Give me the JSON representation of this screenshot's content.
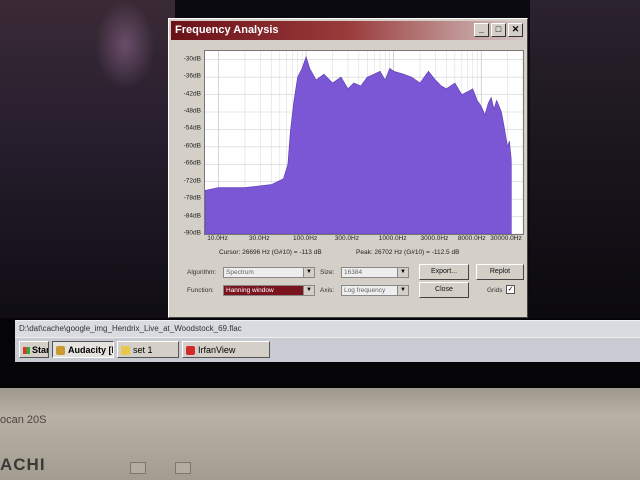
{
  "window": {
    "title": "Frequency Analysis",
    "controls": {
      "minimize": "_",
      "maximize": "□",
      "close": "✕"
    }
  },
  "chart_data": {
    "type": "area",
    "title": "",
    "xlabel": "",
    "ylabel": "",
    "x_scale": "log",
    "xlim": [
      7,
      30000
    ],
    "ylim": [
      -90,
      -27
    ],
    "grid": true,
    "fill_color": "#7b57d6",
    "y_ticks": [
      "-30dB",
      "-36dB",
      "-42dB",
      "-48dB",
      "-54dB",
      "-60dB",
      "-66dB",
      "-72dB",
      "-78dB",
      "-84dB",
      "-90dB"
    ],
    "y_tick_values": [
      -30,
      -36,
      -42,
      -48,
      -54,
      -60,
      -66,
      -72,
      -78,
      -84,
      -90
    ],
    "x_ticks": [
      "10.0Hz",
      "30.0Hz",
      "100.0Hz",
      "300.0Hz",
      "1000.0Hz",
      "3000.0Hz",
      "8000.0Hz",
      "30000.0Hz"
    ],
    "x_tick_values": [
      10,
      30,
      100,
      300,
      1000,
      3000,
      8000,
      30000
    ],
    "series": [
      {
        "x": [
          7,
          10,
          20,
          40,
          55,
          62,
          66,
          72,
          80,
          90,
          100,
          110,
          130,
          160,
          200,
          250,
          300,
          350,
          420,
          500,
          600,
          700,
          800,
          900,
          1000,
          1300,
          1600,
          2000,
          2500,
          3000,
          3500,
          4000,
          5000,
          6000,
          7000,
          8000,
          9000,
          10000,
          11000,
          12000,
          13000,
          14000,
          15000,
          16000,
          17000,
          18000,
          19000,
          20000,
          21000,
          22000,
          22050
        ],
        "y": [
          -75,
          -74,
          -74,
          -73,
          -71,
          -66,
          -55,
          -45,
          -36,
          -33,
          -29,
          -33,
          -37,
          -35,
          -38,
          -36,
          -40,
          -38,
          -39,
          -36,
          -35,
          -34,
          -37,
          -33,
          -34,
          -35,
          -36,
          -38,
          -34,
          -37,
          -39,
          -40,
          -38,
          -42,
          -41,
          -40,
          -44,
          -46,
          -49,
          -45,
          -43,
          -47,
          -44,
          -46,
          -48,
          -52,
          -56,
          -60,
          -58,
          -64,
          -66
        ]
      }
    ]
  },
  "readouts": {
    "cursor": "Cursor: 26696 Hz (G#10) = -113 dB",
    "peak": "Peak: 26702 Hz (G#10) = -112.5 dB"
  },
  "controls": {
    "algorithm_label": "Algorithm:",
    "algorithm_value": "Spectrum",
    "function_label": "Function:",
    "function_value": "Hanning window",
    "size_label": "Size:",
    "size_value": "16384",
    "axis_label": "Axis:",
    "axis_value": "Log frequency",
    "export_label": "Export...",
    "replot_label": "Replot",
    "close_label": "Close",
    "grids_label": "Grids",
    "grids_checked": "✓"
  },
  "statusbar": {
    "text": "D:\\dat\\cache\\google_img_Hendrix_Live_at_Woodstock_69.flac"
  },
  "taskbar": {
    "start": "Start",
    "items": [
      {
        "label": "Audacity [R...",
        "icon": "headphones-icon"
      },
      {
        "label": "set 1",
        "icon": "folder-icon"
      },
      {
        "label": "IrfanView",
        "icon": "irfanview-icon"
      }
    ]
  },
  "photo": {
    "brand": "ACHI",
    "model": "ocan 20S"
  }
}
